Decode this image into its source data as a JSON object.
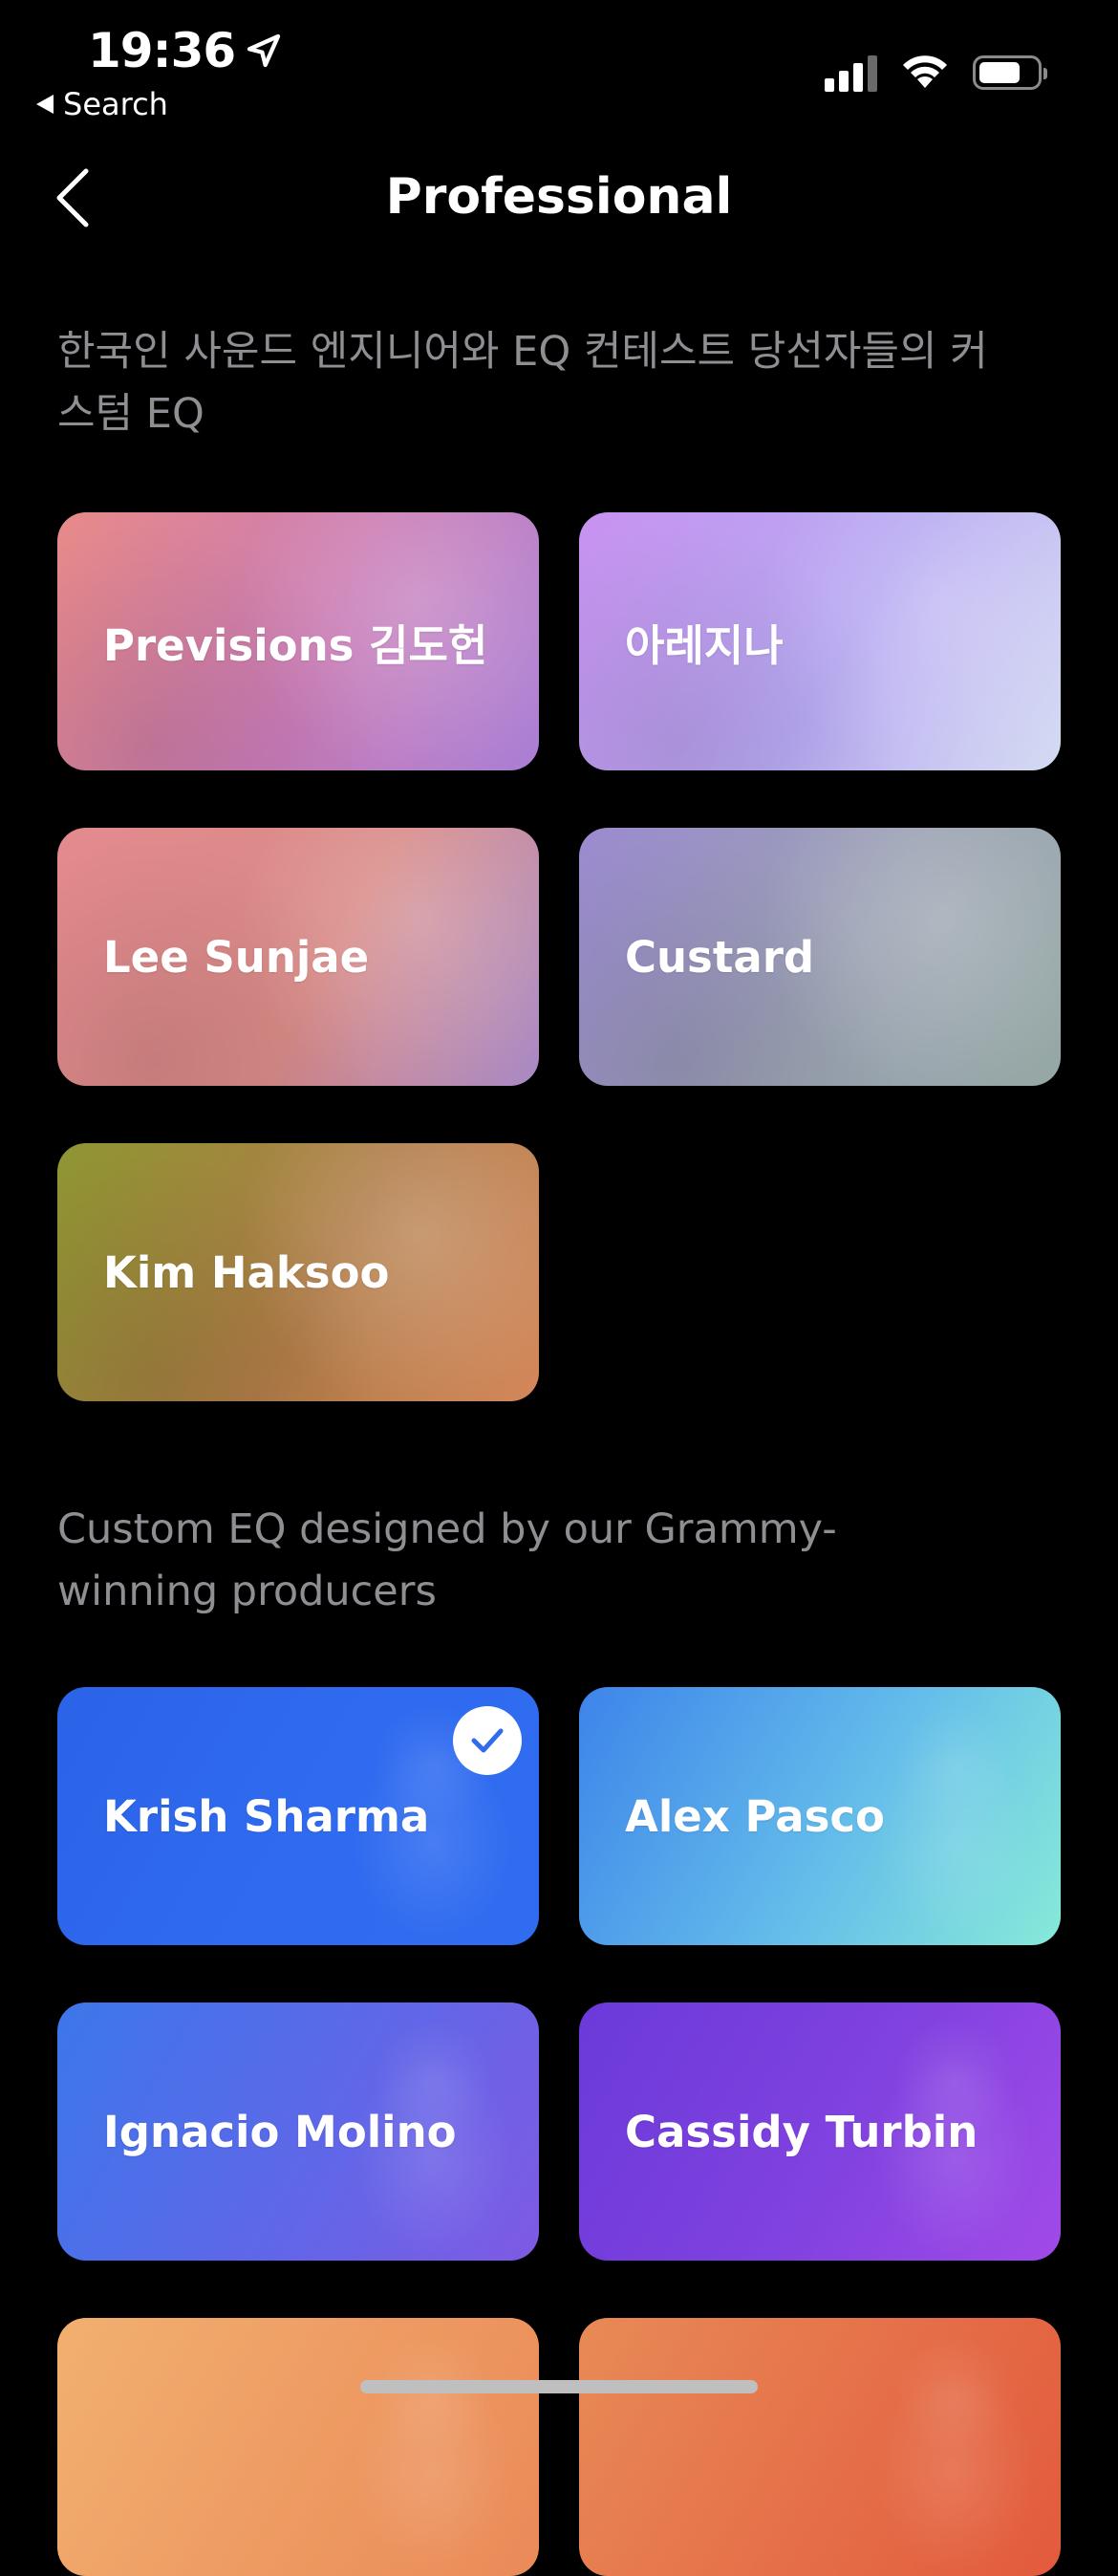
{
  "status_bar": {
    "time": "19:36",
    "back_to_app": "Search"
  },
  "nav": {
    "title": "Professional"
  },
  "sections": [
    {
      "description": "한국인 사운드 엔지니어와 EQ 컨테스트 당선자들의 커스텀 EQ",
      "cards": [
        {
          "label": "Previsions 김도헌",
          "gradient": [
            "#e88a88",
            "#c97bb6",
            "#a97fd6"
          ]
        },
        {
          "label": "아레지나",
          "gradient": [
            "#c792f0",
            "#b7a9f2",
            "#d5dcf2"
          ]
        },
        {
          "label": "Lee Sunjae",
          "gradient": [
            "#e48a8f",
            "#d88a86",
            "#a88ac6"
          ]
        },
        {
          "label": "Custard",
          "gradient": [
            "#9b8ad0",
            "#9aa1b2",
            "#95a8a4"
          ]
        },
        {
          "label": "Kim Haksoo",
          "gradient": [
            "#8e9632",
            "#b07b47",
            "#d4875a"
          ]
        }
      ]
    },
    {
      "description": "Custom EQ designed by our Grammy-winning producers",
      "cards": [
        {
          "label": "Krish Sharma",
          "selected": true,
          "gradient": [
            "#2c63e8",
            "#2f6bf0",
            "#2f6cf0"
          ]
        },
        {
          "label": "Alex Pasco",
          "gradient": [
            "#3d84ea",
            "#64bdea",
            "#86ead8"
          ]
        },
        {
          "label": "Ignacio Molino",
          "gradient": [
            "#3c77ea",
            "#5f67e8",
            "#7f5ae4"
          ]
        },
        {
          "label": "Cassidy Turbin",
          "gradient": [
            "#6a3ad9",
            "#8142e0",
            "#a14ae8"
          ]
        },
        {
          "label": "",
          "gradient": [
            "#f1b070",
            "#ee9a62",
            "#ea8a58"
          ]
        },
        {
          "label": "",
          "gradient": [
            "#e88a56",
            "#e56f48",
            "#e25a3c"
          ]
        }
      ]
    }
  ]
}
